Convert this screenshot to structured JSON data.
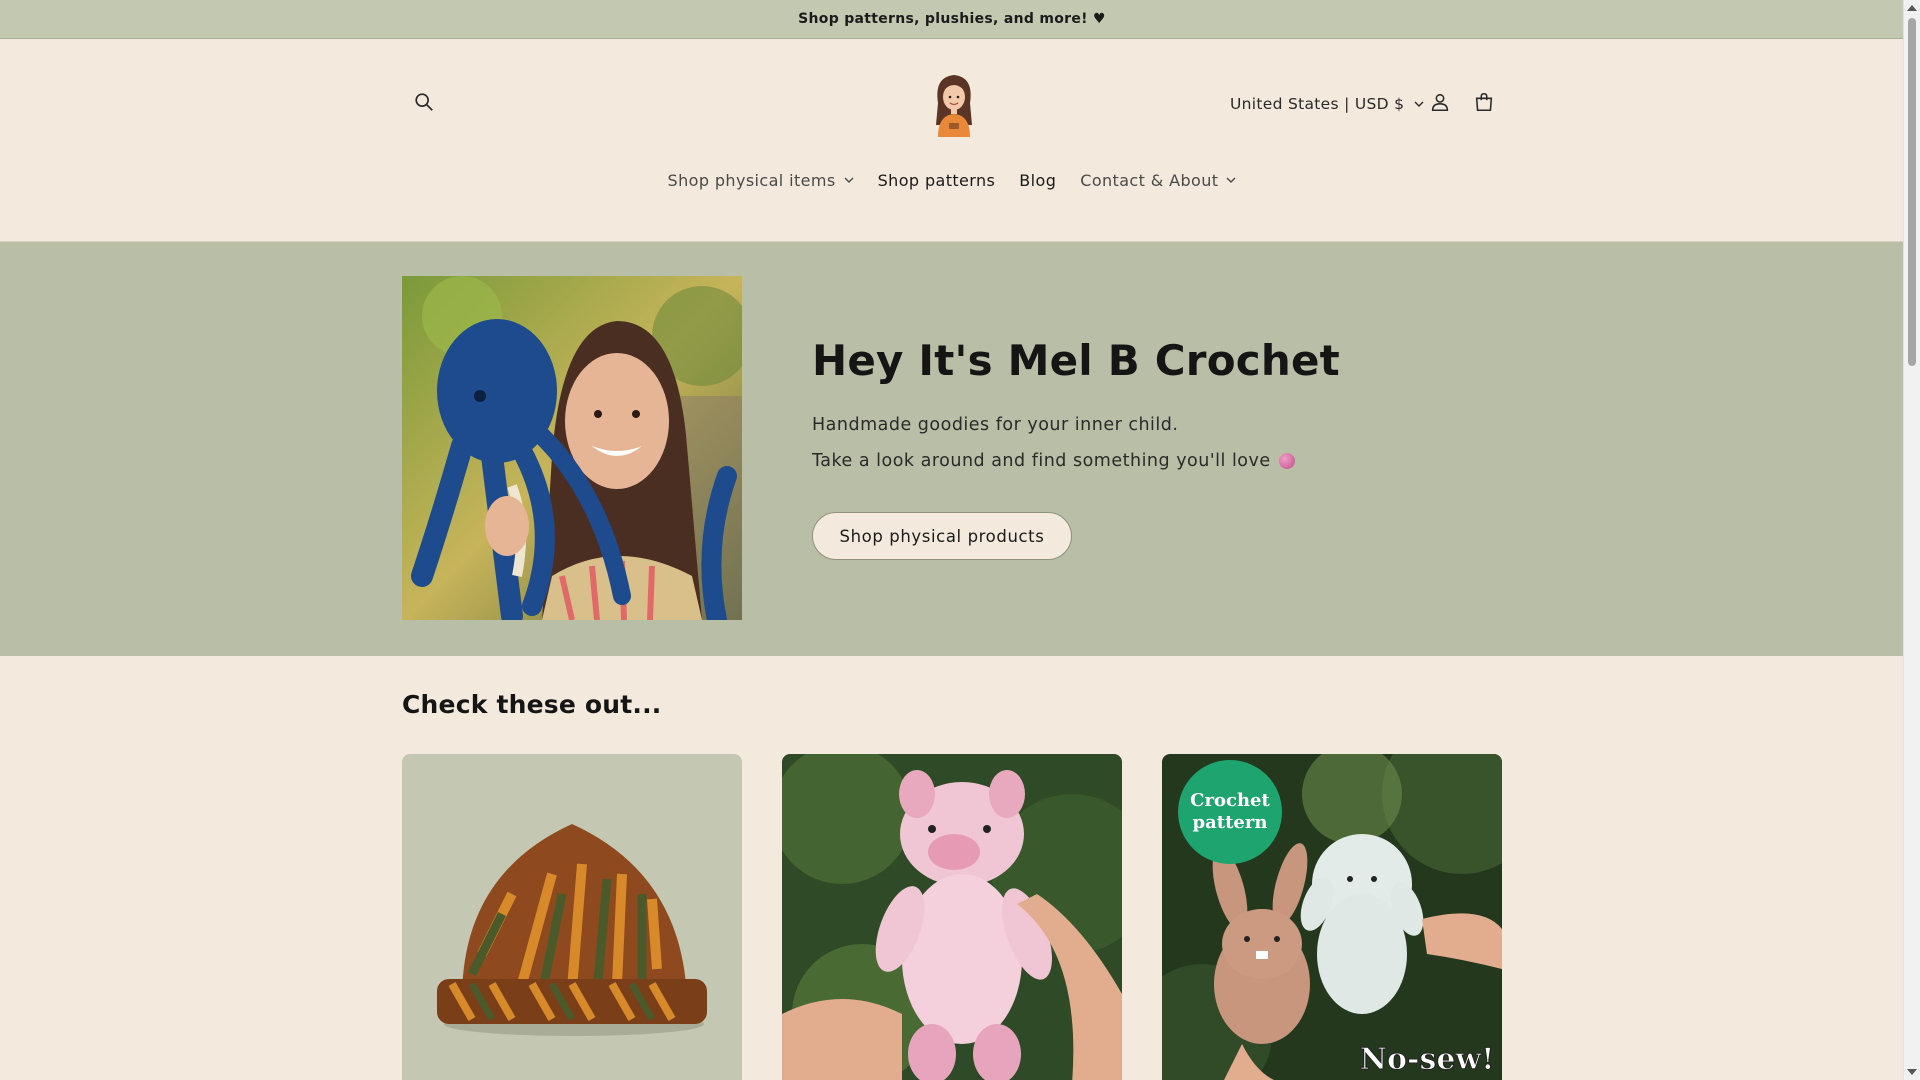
{
  "announcement": {
    "text": "Shop patterns, plushies, and more! ♥"
  },
  "header": {
    "locale": "United States | USD $",
    "icons": {
      "search": "search-icon",
      "account": "account-icon",
      "cart": "cart-icon",
      "logo": "avatar-logo"
    }
  },
  "nav": {
    "items": [
      {
        "label": "Shop physical items",
        "has_dropdown": true
      },
      {
        "label": "Shop patterns",
        "has_dropdown": false
      },
      {
        "label": "Blog",
        "has_dropdown": false
      },
      {
        "label": "Contact & About",
        "has_dropdown": true
      }
    ]
  },
  "hero": {
    "title": "Hey It's Mel B Crochet",
    "line1": "Handmade goodies for your inner child.",
    "line2": "Take a look around and find something you'll love",
    "button": "Shop physical products"
  },
  "featured": {
    "title": "Check these out...",
    "cards": [
      {
        "kind": "hat"
      },
      {
        "kind": "pig-plushie"
      },
      {
        "kind": "bunny-pattern",
        "badge_line1": "Crochet",
        "badge_line2": "pattern",
        "overlay": "No-sew!"
      }
    ]
  },
  "colors": {
    "announcement_bg": "#c3c8b0",
    "hero_bg": "#b9bfa6",
    "page_bg": "#f3e9dc",
    "badge": "#1ea46f"
  }
}
